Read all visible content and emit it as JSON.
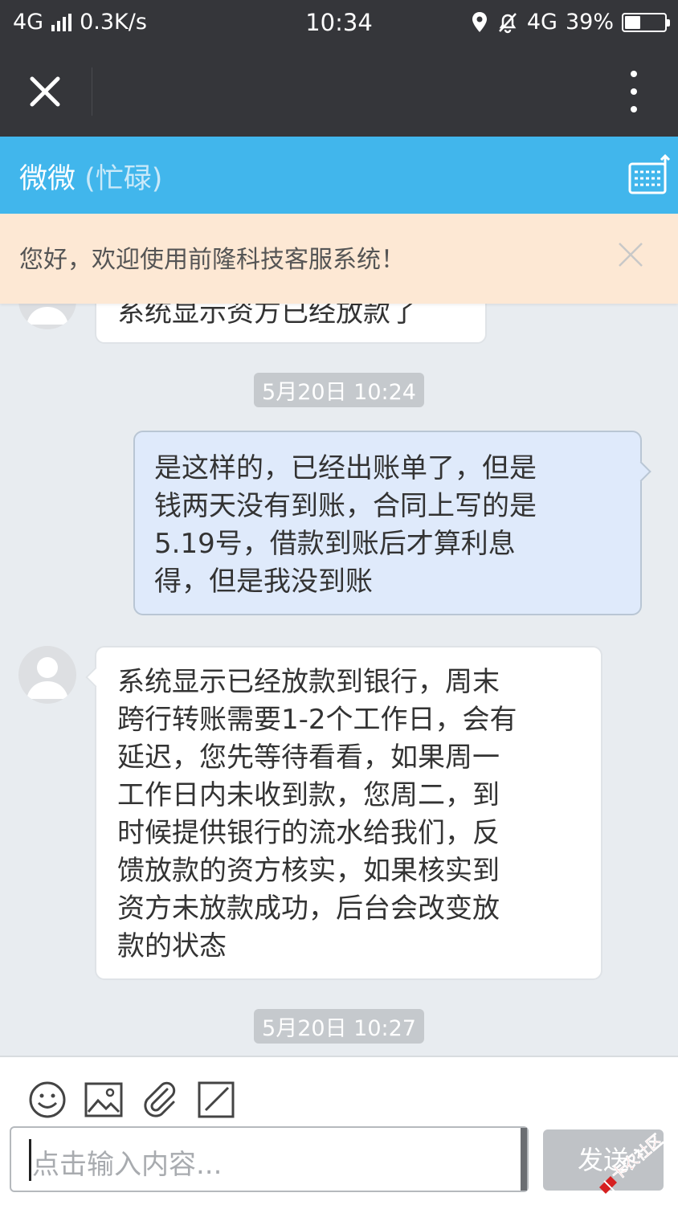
{
  "status_bar": {
    "network": "4G",
    "speed": "0.3K/s",
    "time": "10:34",
    "network2": "4G",
    "battery": "39%",
    "battery_level": 0.39
  },
  "header": {
    "contact_name": "微微",
    "contact_status": "(忙碌)"
  },
  "notice": {
    "text": "您好，欢迎使用前隆科技客服系统！"
  },
  "messages": [
    {
      "side": "in",
      "text": "系统显示资方已经放款了"
    },
    {
      "side": "stamp",
      "text": "5月20日 10:24"
    },
    {
      "side": "out",
      "lines": [
        "是这样的，已经出账单了，但是",
        "钱两天没有到账，合同上写的是",
        "5.19号，借款到账后才算利息",
        "得，但是我没到账"
      ]
    },
    {
      "side": "in",
      "lines": [
        "系统显示已经放款到银行，周末",
        "跨行转账需要1-2个工作日，会有",
        "延迟，您先等待看看，如果周一",
        "工作日内未收到款，您周二，到",
        "时候提供银行的流水给我们，反",
        "馈放款的资方核实，如果核实到",
        "资方未放款成功，后台会改变放",
        "款的状态"
      ]
    },
    {
      "side": "stamp",
      "text": "5月20日 10:27"
    }
  ],
  "composer": {
    "placeholder": "点击输入内容...",
    "send_label": "发送"
  },
  "watermark": "卡农社区",
  "colors": {
    "dark_bar": "#35363a",
    "chat_header": "#41b6ec",
    "notice_bg": "#fde8d4",
    "chat_bg": "#e8ecf0",
    "out_bubble": "#dfeafb"
  }
}
